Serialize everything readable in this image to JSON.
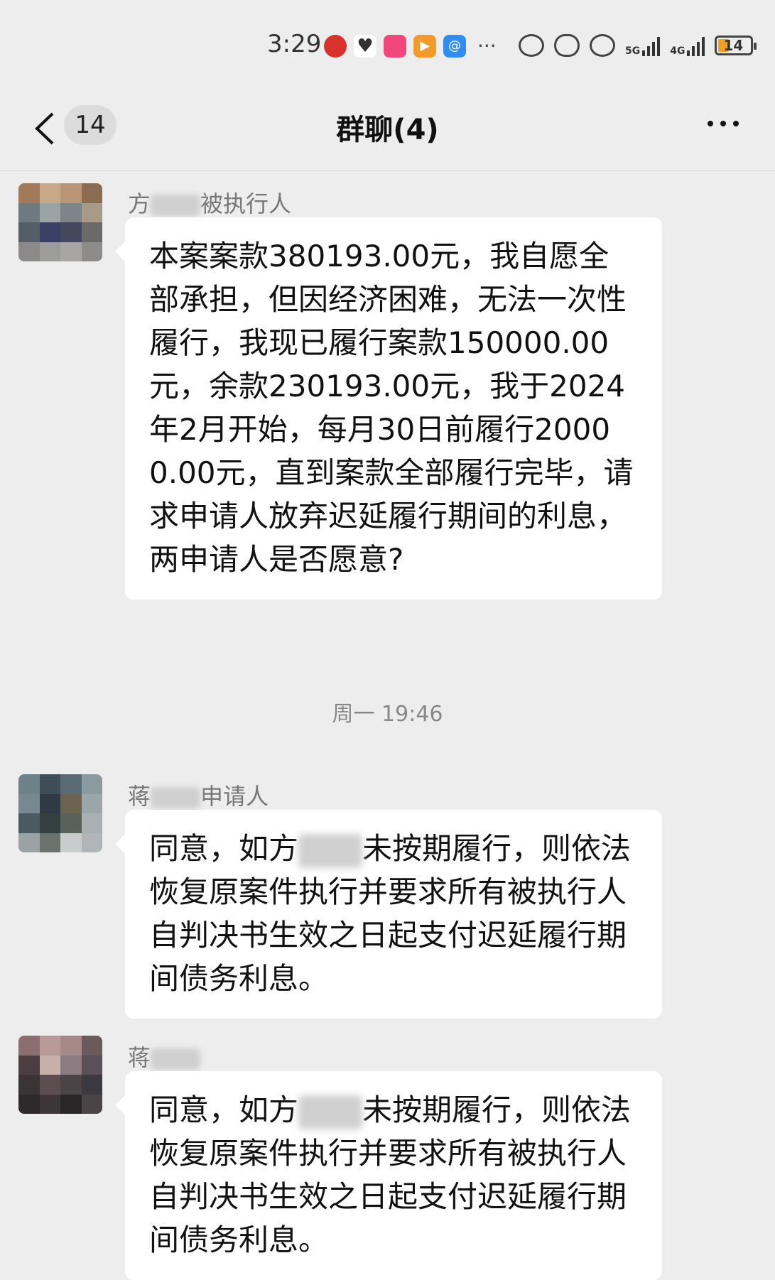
{
  "status_bar": {
    "time": "3:29",
    "net1": "5G",
    "net2": "4G",
    "battery": "14"
  },
  "nav": {
    "unread_count": "14",
    "title": "群聊(4)"
  },
  "messages": [
    {
      "sender_prefix": "方",
      "sender_suffix": "被执行人",
      "text": "本案案款380193.00元，我自愿全部承担，但因经济困难，无法一次性履行，我现已履行案款150000.00元，余款230193.00元，我于2024年2月开始，每月30日前履行20000.00元，直到案款全部履行完毕，请求申请人放弃迟延履行期间的利息，两申请人是否愿意?"
    },
    {
      "sender_prefix": "蒋",
      "sender_suffix": "申请人",
      "text_a": "同意，如方",
      "text_b": "未按期履行，则依法恢复原案件执行并要求所有被执行人自判决书生效之日起支付迟延履行期间债务利息。"
    },
    {
      "sender_prefix": "蒋",
      "sender_suffix": "",
      "text_a": "同意，如方",
      "text_b": "未按期履行，则依法恢复原案件执行并要求所有被执行人自判决书生效之日起支付迟延履行期间债务利息。"
    }
  ],
  "timestamp": "周一 19:46"
}
